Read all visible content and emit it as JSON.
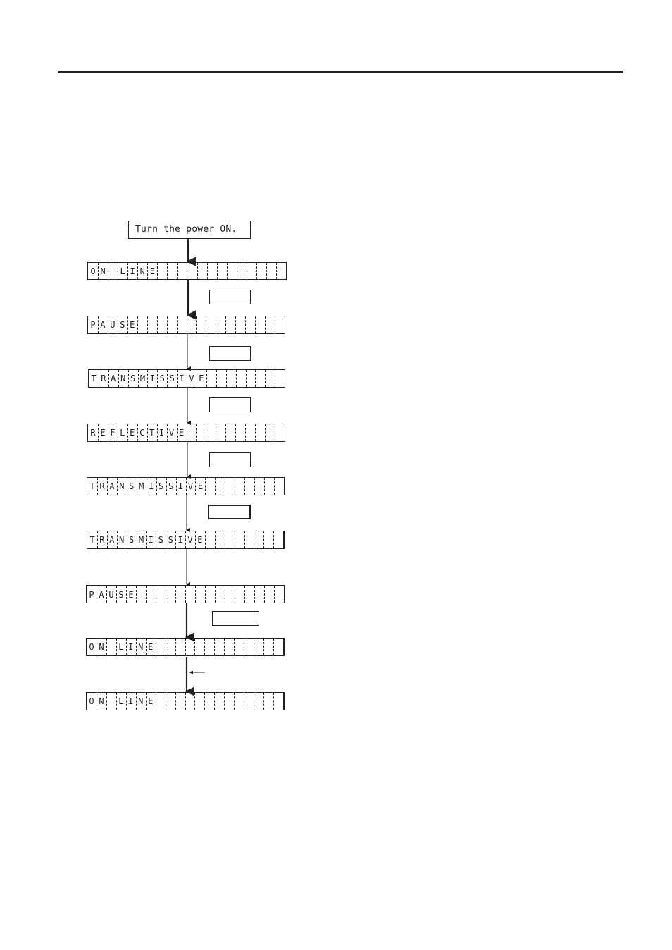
{
  "page": {
    "header_rule": true
  },
  "flowchart": {
    "start": "Turn the power ON.",
    "displays": [
      {
        "text": "ON LINE"
      },
      {
        "text": "PAUSE"
      },
      {
        "text": "TRANSMISSIVE"
      },
      {
        "text": "REFLECTIVE"
      },
      {
        "text": "TRANSMISSIVE"
      },
      {
        "text": "TRANSMISSIVE"
      },
      {
        "text": "PAUSE"
      },
      {
        "text": "ON LINE"
      },
      {
        "text": "ON LINE"
      }
    ],
    "display_cells": 20,
    "key_labels": [
      "",
      "",
      "",
      "",
      "",
      ""
    ]
  }
}
